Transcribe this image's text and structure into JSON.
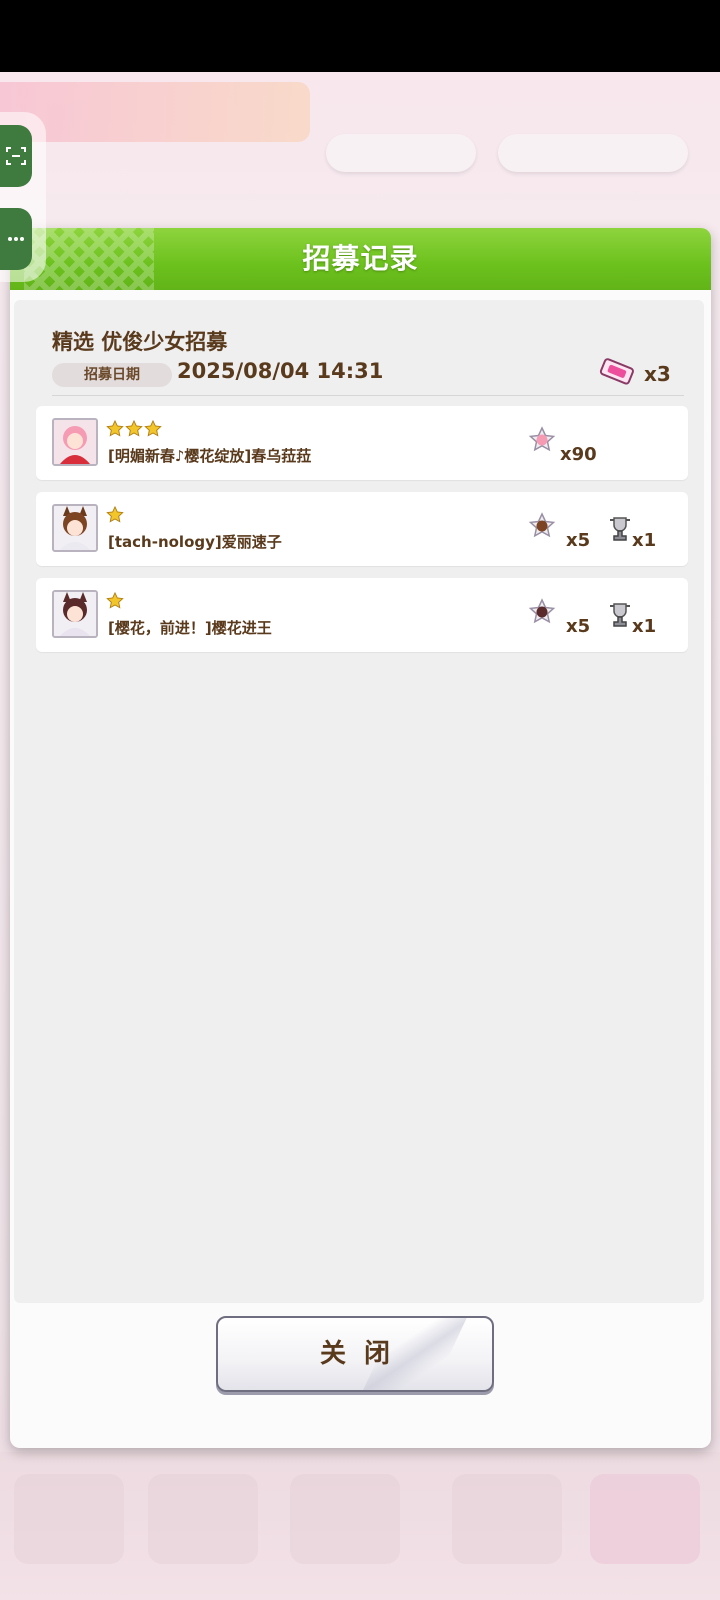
{
  "dialog": {
    "title": "招募记录",
    "gacha_name": "精选 优俊少女招募",
    "date_label": "招募日期",
    "date_value": "2025/08/04 14:31",
    "ticket_count": "x3",
    "close_label": "关闭"
  },
  "results": [
    {
      "stars": 3,
      "name": "[明媚新春♪樱花绽放]春乌菈菈",
      "reward1_count": "x90",
      "reward2_count": ""
    },
    {
      "stars": 1,
      "name": "[tach-nology]爱丽速子",
      "reward1_count": "x5",
      "reward2_count": "x1"
    },
    {
      "stars": 1,
      "name": "[樱花，前进！]樱花进王",
      "reward1_count": "x5",
      "reward2_count": "x1"
    }
  ],
  "colors": {
    "header_green": "#6cc11d",
    "text_brown": "#5a3a1c",
    "star_gold": "#f2c52a"
  },
  "icons": {
    "ticket": "gacha-ticket-icon",
    "piece": "character-piece-icon",
    "trophy": "trophy-icon",
    "star": "star-icon"
  }
}
